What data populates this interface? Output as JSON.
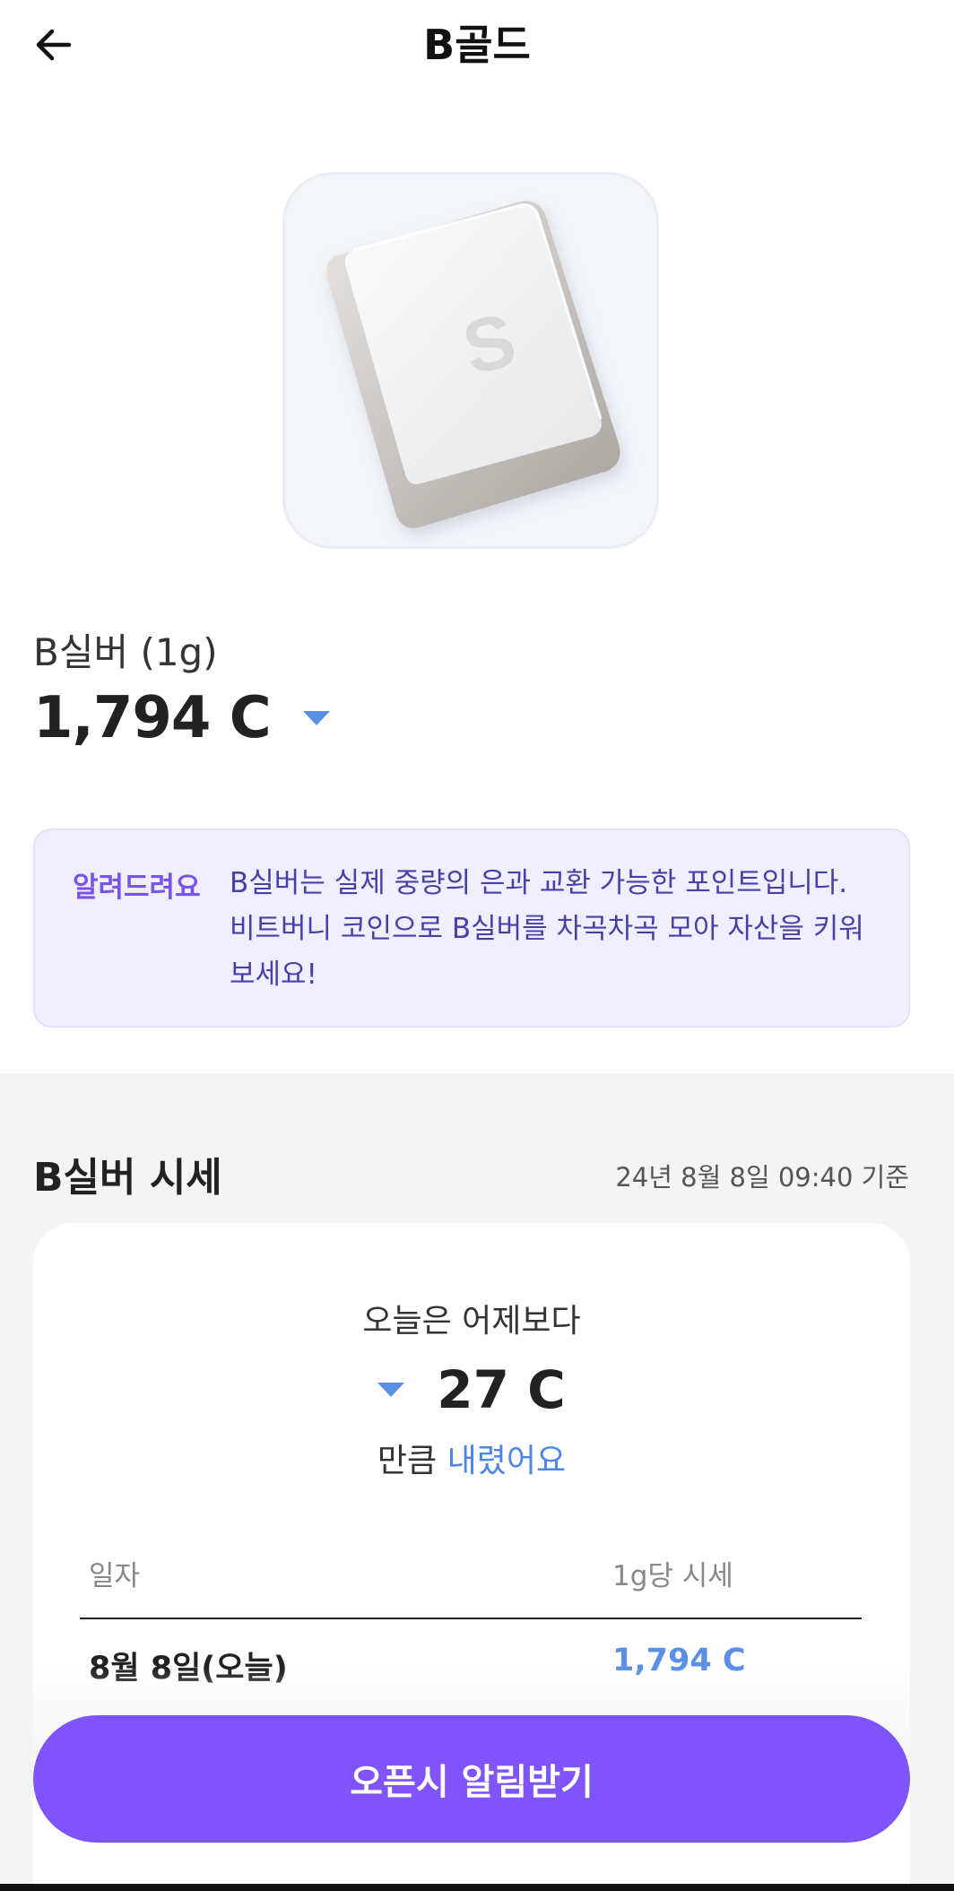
{
  "header": {
    "title": "B골드",
    "back_icon": "arrow-left-icon"
  },
  "product": {
    "image_icon": "silver-bar-icon",
    "bar_letter": "S",
    "name": "B실버 (1g)",
    "price": "1,794 C",
    "trend": "down",
    "trend_color": "#5b8fe6"
  },
  "notice": {
    "label": "알려드려요",
    "text": "B실버는 실제 중량의 은과 교환 가능한 포인트입니다. 비트버니 코인으로 B실버를 차곡차곡 모아 자산을 키워보세요!",
    "label_color": "#7b52ee"
  },
  "market": {
    "title": "B실버 시세",
    "as_of": "24년 8월 8일 09:40 기준",
    "compare_label": "오늘은 어제보다",
    "compare_value": "27 C",
    "compare_prefix": "만큼",
    "compare_direction": "내렸어요",
    "table": {
      "headers": {
        "date": "일자",
        "price": "1g당 시세"
      },
      "rows": [
        {
          "date": "8월 8일(오늘)",
          "price": "1,794 C"
        }
      ]
    }
  },
  "cta": {
    "label": "오픈시 알림받기",
    "color": "#7f54fb"
  }
}
